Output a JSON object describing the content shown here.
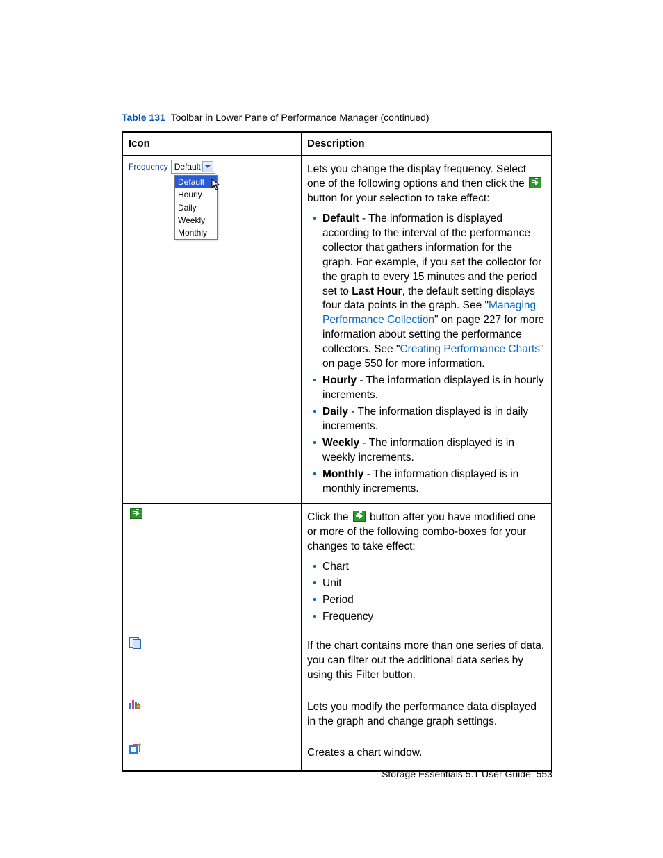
{
  "caption": {
    "label": "Table 131",
    "title": "Toolbar in Lower Pane of Performance Manager (continued)"
  },
  "headers": {
    "icon": "Icon",
    "desc": "Description"
  },
  "freq": {
    "label": "Frequency",
    "selected": "Default",
    "options": [
      "Default",
      "Hourly",
      "Daily",
      "Weekly",
      "Monthly"
    ]
  },
  "rows": {
    "freq_desc": {
      "intro_a": "Lets you change the display frequency. Select one of the following options and then click the ",
      "intro_b": " button for your selection to take effect:",
      "items": {
        "default_a": " - The information is displayed according to the interval of the performance collector that gathers information for the graph. For example, if you set the collector for the graph to every 15 minutes and the period set to ",
        "default_lh": "Last Hour",
        "default_b": ", the default setting displays four data points in the graph. See \"",
        "default_link1": "Managing Performance Collection",
        "default_c": "\" on page 227 for more information about setting the performance collectors. See \"",
        "default_link2": "Creating Performance Charts",
        "default_d": "\" on page 550 for more information.",
        "hourly": " - The information displayed is in hourly increments.",
        "daily": " - The information displayed is in daily increments.",
        "weekly": " - The information displayed is in weekly increments.",
        "monthly": " - The information displayed is in monthly increments."
      },
      "names": {
        "default": "Default",
        "hourly": "Hourly",
        "daily": "Daily",
        "weekly": "Weekly",
        "monthly": "Monthly"
      }
    },
    "go_desc": {
      "a": "Click the ",
      "b": " button after you have modified one or more of the following combo-boxes for your changes to take effect:",
      "items": [
        "Chart",
        "Unit",
        "Period",
        "Frequency"
      ]
    },
    "filter_desc": "If the chart contains more than one series of data, you can filter out the additional data series by using this Filter button.",
    "props_desc": "Lets you modify the performance data displayed in the graph and change graph settings.",
    "chart_desc": "Creates a chart window."
  },
  "footer": {
    "text": "Storage Essentials 5.1 User Guide",
    "page": "553"
  }
}
